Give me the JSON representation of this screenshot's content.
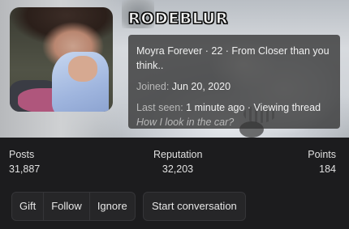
{
  "profile": {
    "username": "RODEBLUR",
    "title_line": "Moyra Forever · 22 · From Closer than you think..",
    "joined_label": "Joined:",
    "joined_value": "Jun 20, 2020",
    "last_seen_label": "Last seen:",
    "last_seen_value": "1 minute ago · Viewing thread",
    "activity_link": "How I look in the car?"
  },
  "stats": {
    "posts_label": "Posts",
    "posts_value": "31,887",
    "reputation_label": "Reputation",
    "reputation_value": "32,203",
    "points_label": "Points",
    "points_value": "184"
  },
  "actions": {
    "gift": "Gift",
    "follow": "Follow",
    "ignore": "Ignore",
    "start_conversation": "Start conversation"
  }
}
